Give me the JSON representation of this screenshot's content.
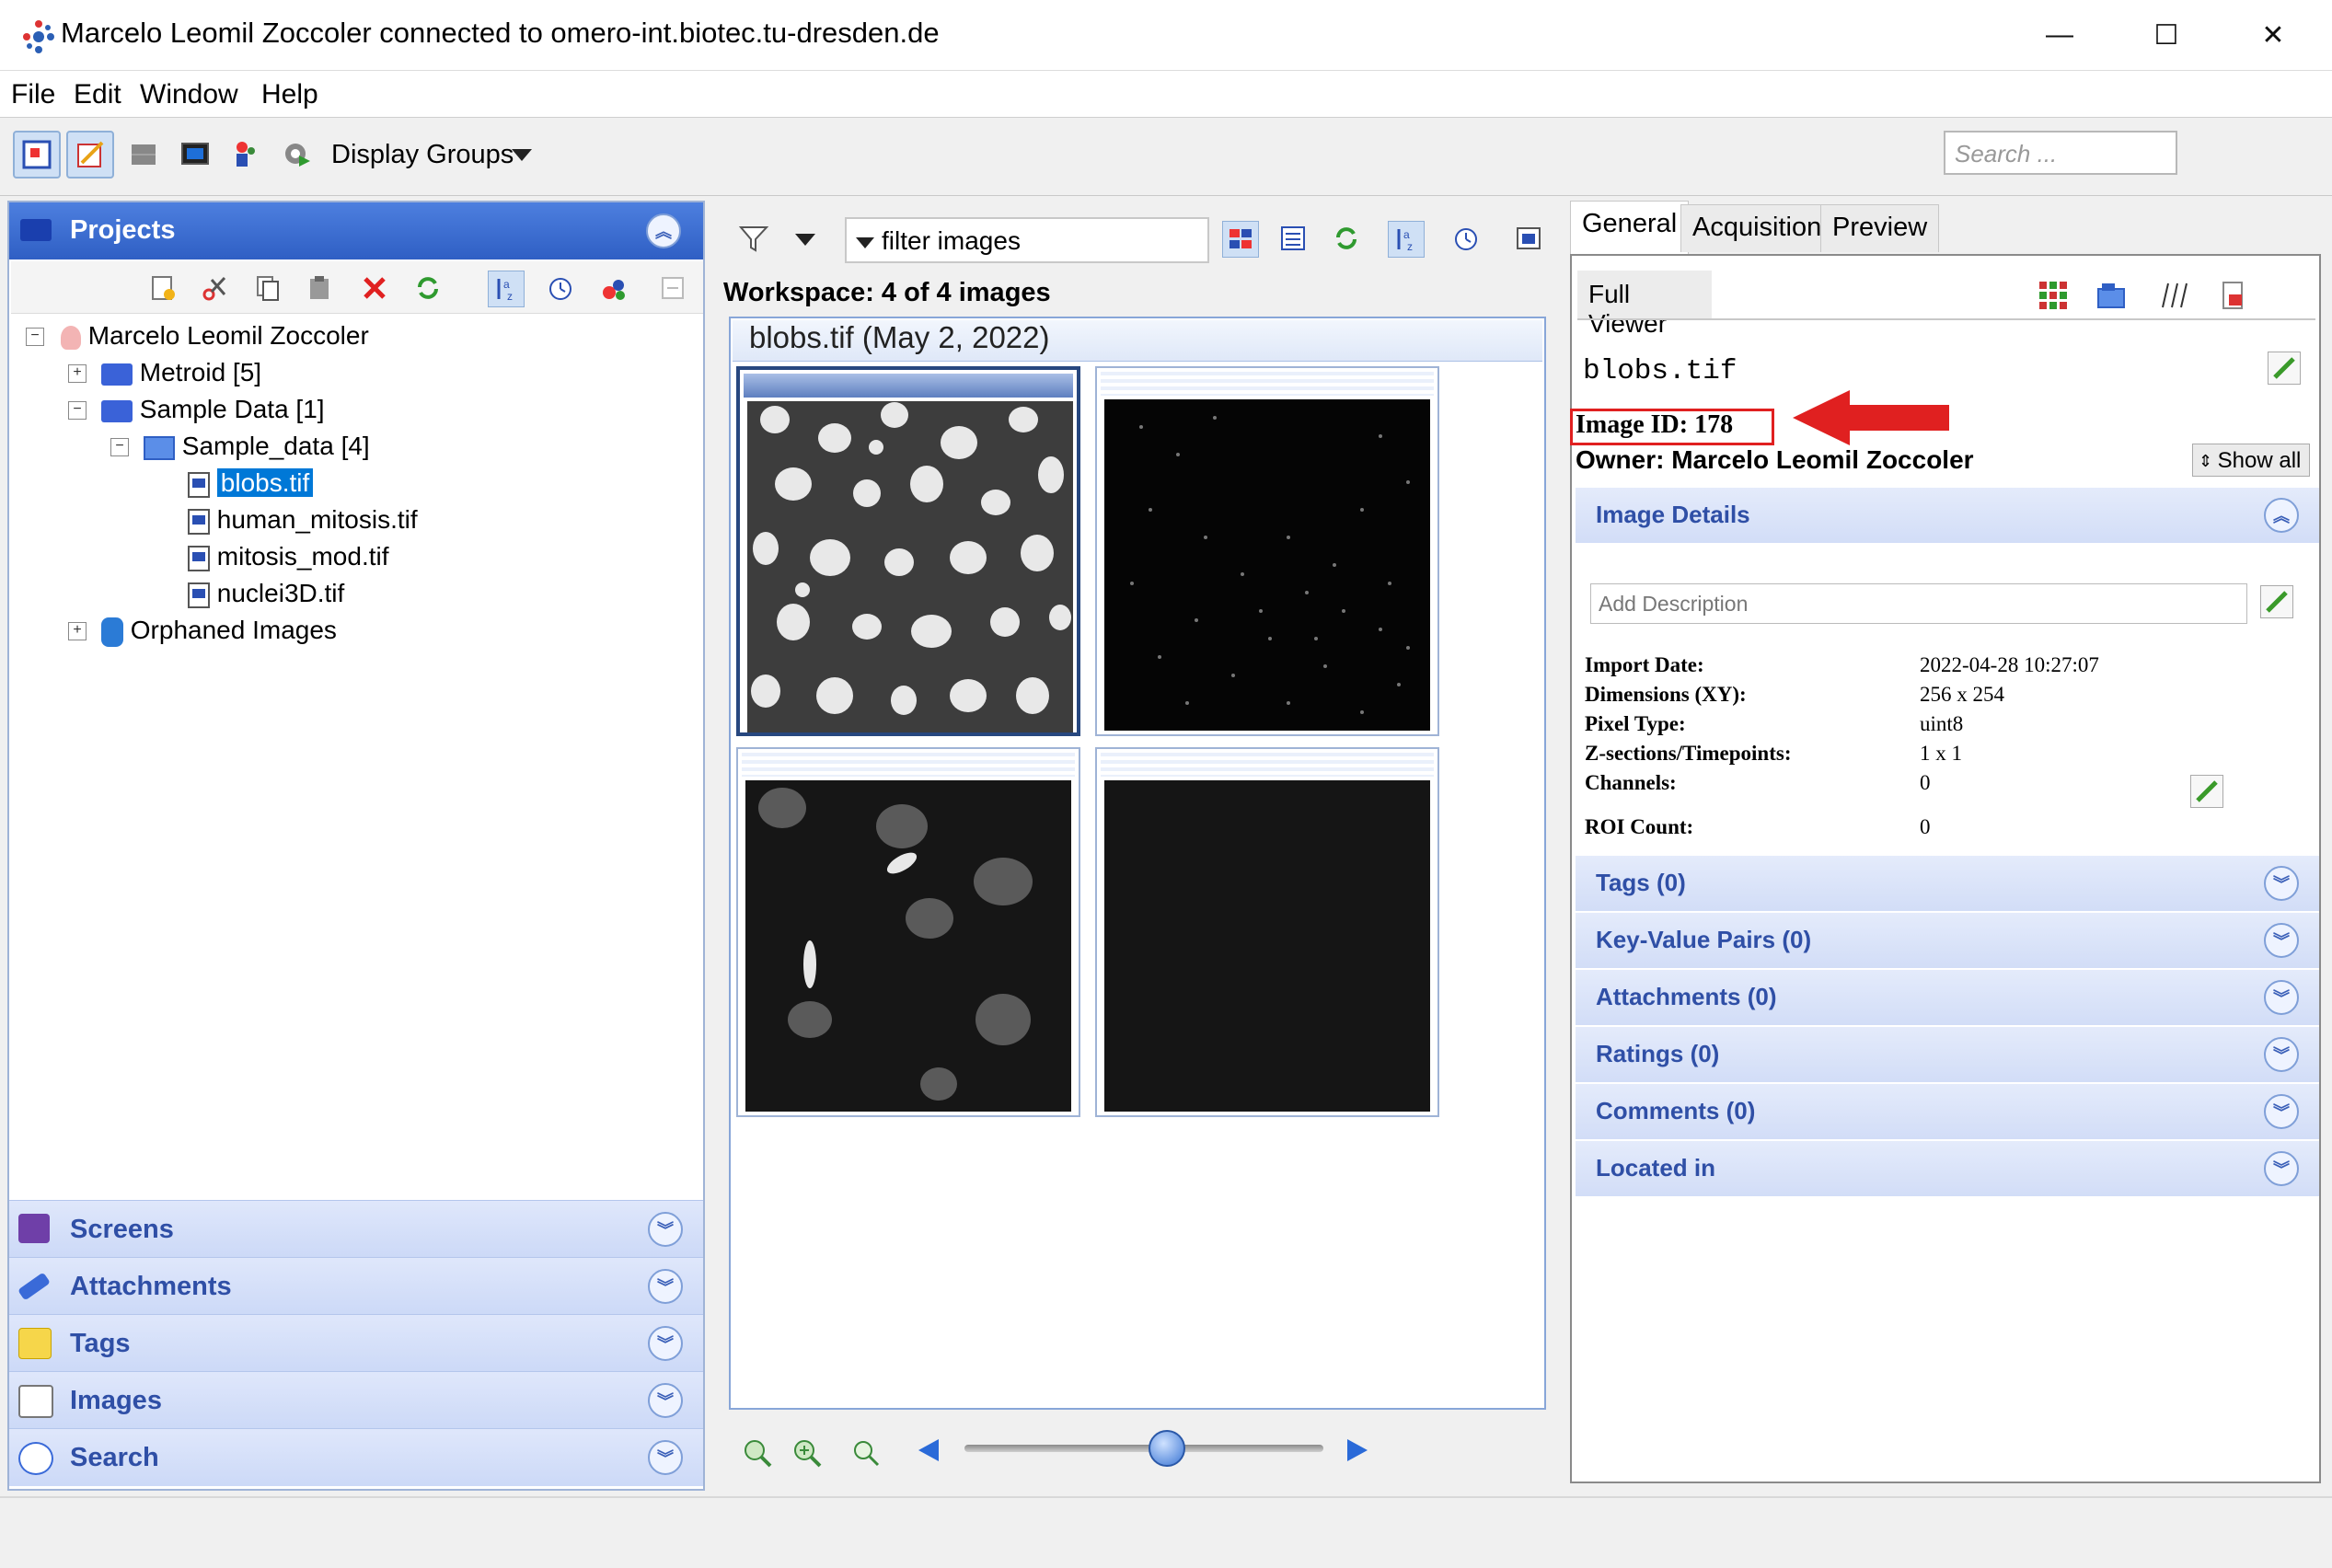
{
  "window": {
    "title": "Marcelo Leomil Zoccoler connected to omero-int.biotec.tu-dresden.de",
    "controls": [
      "—",
      "☐",
      "✕"
    ]
  },
  "menu": [
    "File",
    "Edit",
    "Window",
    "Help"
  ],
  "toolbar": {
    "display_groups": "Display Groups",
    "search_placeholder": "Search ..."
  },
  "left": {
    "projects_title": "Projects",
    "tree": {
      "user": "Marcelo Leomil Zoccoler",
      "project1": "Metroid [5]",
      "project2": "Sample Data [1]",
      "dataset": "Sample_data [4]",
      "images": [
        "blobs.tif",
        "human_mitosis.tif",
        "mitosis_mod.tif",
        "nuclei3D.tif"
      ],
      "orphaned": "Orphaned Images"
    },
    "accordions": [
      "Screens",
      "Attachments",
      "Tags",
      "Images",
      "Search"
    ]
  },
  "middle": {
    "filter_text": "filter  images",
    "workspace": "Workspace: 4 of 4 images",
    "group_title": "blobs.tif (May 2, 2022)",
    "thumbnails": [
      "blobs.tif",
      "human_mitosis.tif",
      "mitosis_mod.tif",
      "nuclei3D.tif"
    ]
  },
  "right": {
    "tabs": [
      "General",
      "Acquisition",
      "Preview"
    ],
    "full_viewer": "Full Viewer",
    "image_name": "blobs.tif",
    "image_id": "Image ID: 178",
    "owner": "Owner: Marcelo Leomil Zoccoler",
    "show_all": "Show all",
    "image_details": "Image Details",
    "description_placeholder": "Add Description",
    "details": {
      "import_date_label": "Import Date:",
      "import_date": "2022-04-28 10:27:07",
      "dimensions_label": "Dimensions (XY):",
      "dimensions": "256 x 254",
      "pixel_type_label": "Pixel Type:",
      "pixel_type": "uint8",
      "zsections_label": "Z-sections/Timepoints:",
      "zsections": "1 x 1",
      "channels_label": "Channels:",
      "channels": "0",
      "roi_label": "ROI Count:",
      "roi": "0"
    },
    "sections": [
      "Tags (0)",
      "Key-Value Pairs (0)",
      "Attachments (0)",
      "Ratings (0)",
      "Comments (0)",
      "Located in"
    ]
  },
  "colors": {
    "accent": "#2f5fc4",
    "highlight_red": "#e02020",
    "selection": "#0078d7"
  }
}
